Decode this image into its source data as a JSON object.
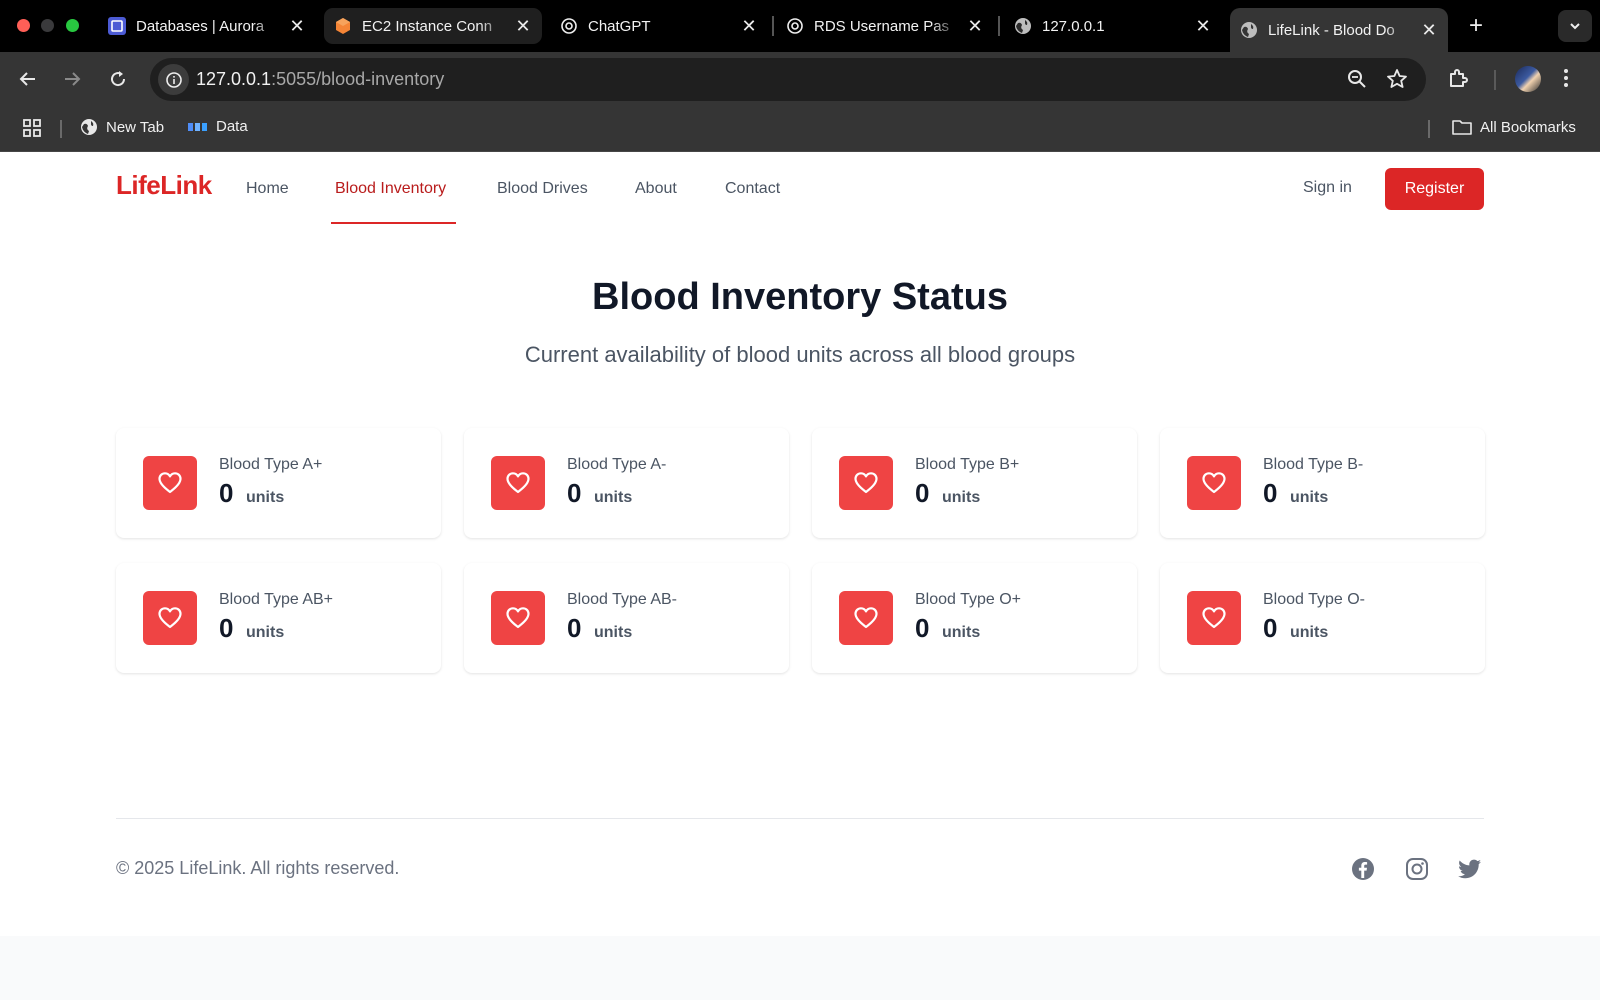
{
  "browser": {
    "tabs": [
      {
        "title": "Databases | Aurora",
        "icon": "rds-icon"
      },
      {
        "title": "EC2 Instance Conn",
        "icon": "ec2-icon"
      },
      {
        "title": "ChatGPT",
        "icon": "openai-icon"
      },
      {
        "title": "RDS Username Pas",
        "icon": "openai-icon"
      },
      {
        "title": "127.0.0.1",
        "icon": "globe-icon"
      },
      {
        "title": "LifeLink - Blood Do",
        "icon": "globe-icon"
      }
    ],
    "url_host": "127.0.0.1",
    "url_path": ":5055/blood-inventory",
    "bookmarks": [
      {
        "label": "New Tab",
        "icon": "globe-icon"
      },
      {
        "label": "Data",
        "icon": "mds-icon"
      }
    ],
    "all_bookmarks_label": "All Bookmarks"
  },
  "nav": {
    "logo": "LifeLink",
    "links": [
      "Home",
      "Blood Inventory",
      "Blood Drives",
      "About",
      "Contact"
    ],
    "active_link": "Blood Inventory",
    "sign_in": "Sign in",
    "register": "Register"
  },
  "hero": {
    "title": "Blood Inventory Status",
    "subtitle": "Current availability of blood units across all blood groups"
  },
  "inventory": [
    {
      "label": "Blood Type A+",
      "count": "0",
      "unit": "units"
    },
    {
      "label": "Blood Type A-",
      "count": "0",
      "unit": "units"
    },
    {
      "label": "Blood Type B+",
      "count": "0",
      "unit": "units"
    },
    {
      "label": "Blood Type B-",
      "count": "0",
      "unit": "units"
    },
    {
      "label": "Blood Type AB+",
      "count": "0",
      "unit": "units"
    },
    {
      "label": "Blood Type AB-",
      "count": "0",
      "unit": "units"
    },
    {
      "label": "Blood Type O+",
      "count": "0",
      "unit": "units"
    },
    {
      "label": "Blood Type O-",
      "count": "0",
      "unit": "units"
    }
  ],
  "footer": {
    "copyright": "© 2025 LifeLink. All rights reserved.",
    "social": [
      "facebook-icon",
      "instagram-icon",
      "twitter-icon"
    ]
  },
  "colors": {
    "brand_red": "#dc2626",
    "icon_red": "#ef4444",
    "text_dark": "#111827",
    "text_muted": "#4b5563"
  }
}
